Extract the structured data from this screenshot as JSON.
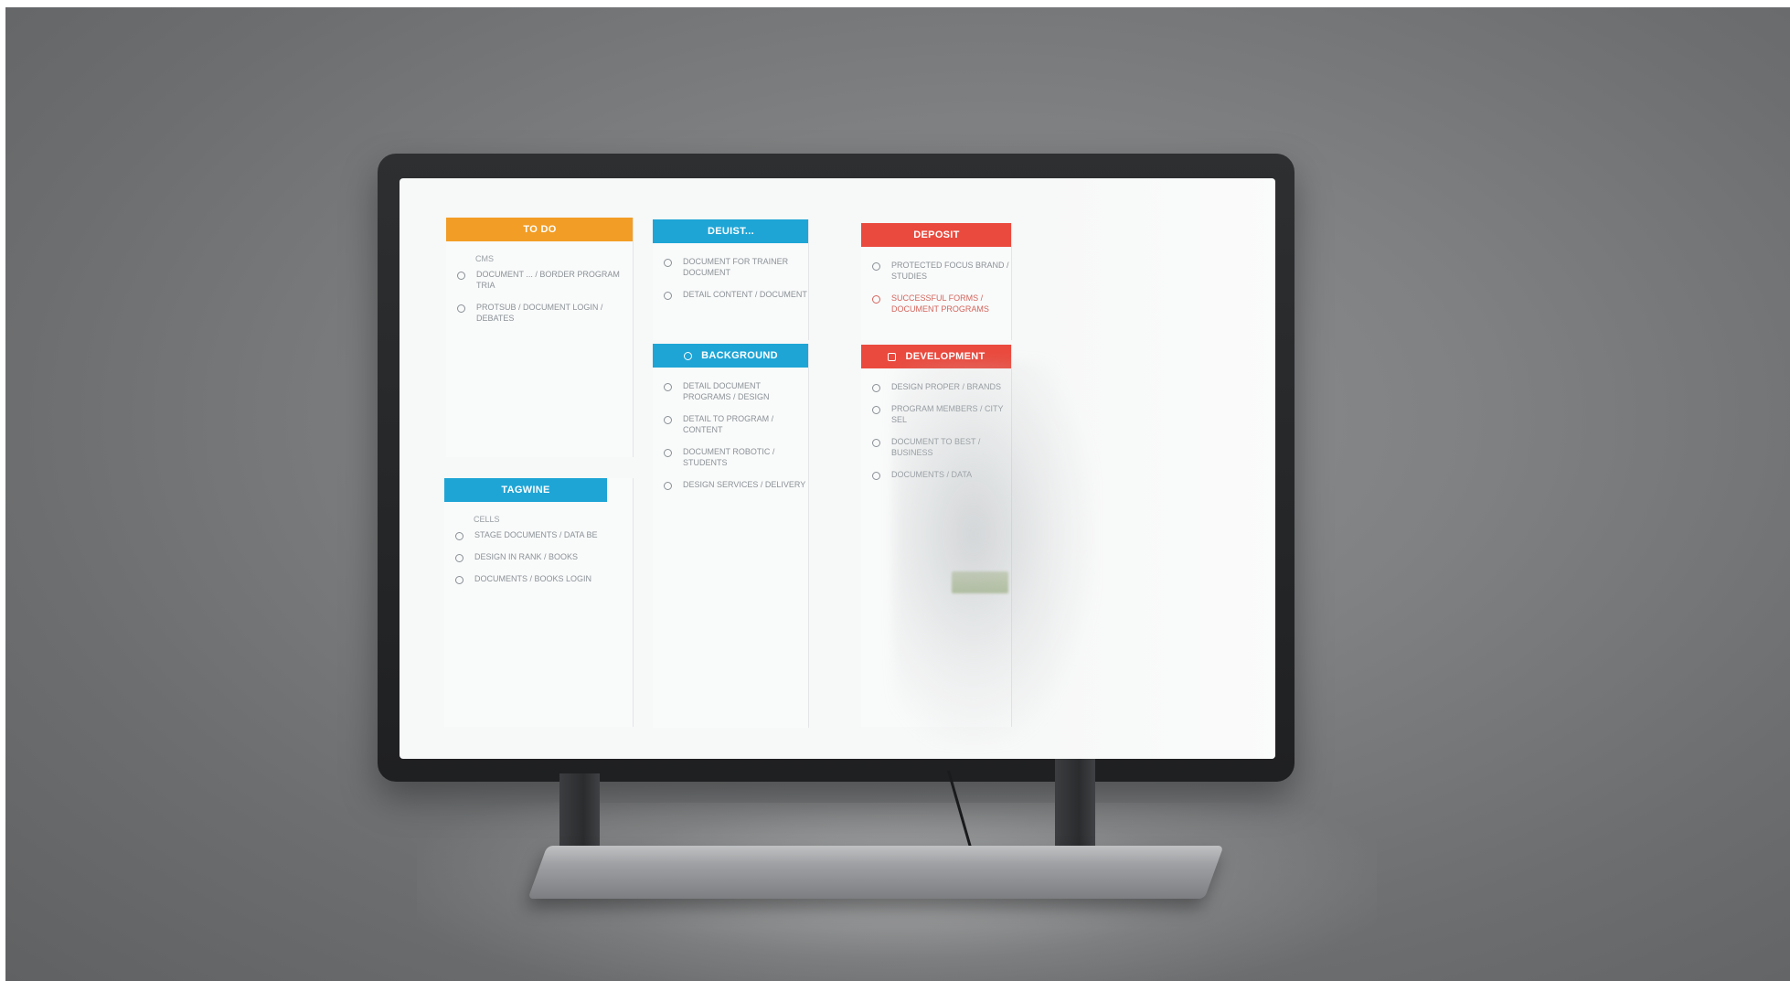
{
  "colors": {
    "orange": "#f29d25",
    "blue": "#1ea5d6",
    "red": "#ea4a3e",
    "bezel": "#232527",
    "backdrop": "#7d7f81"
  },
  "panels": [
    {
      "id": "orange-top",
      "color": "orange",
      "header": "TO DO",
      "sub": "CMS",
      "items": [
        {
          "text": "DOCUMENT ... / BORDER PROGRAM TRIA",
          "tone": "normal"
        },
        {
          "text": "PROTSUB / DOCUMENT LOGIN / DEBATES",
          "tone": "normal"
        }
      ]
    },
    {
      "id": "blue-top",
      "color": "blue",
      "header": "DEUIST...",
      "sub": "",
      "items": [
        {
          "text": "DOCUMENT FOR TRAINER DOCUMENT",
          "tone": "normal"
        },
        {
          "text": "DETAIL CONTENT / DOCUMENT",
          "tone": "normal"
        }
      ]
    },
    {
      "id": "red-top",
      "color": "red",
      "header": "DEPOSIT",
      "sub": "",
      "items": [
        {
          "text": "PROTECTED FOCUS BRAND / STUDIES",
          "tone": "normal"
        },
        {
          "text": "SUCCESSFUL FORMS / DOCUMENT PROGRAMS",
          "tone": "red"
        }
      ]
    },
    {
      "id": "blue-mid",
      "color": "blue",
      "header": "BACKGROUND",
      "sub": "",
      "items": [
        {
          "text": "DETAIL DOCUMENT PROGRAMS / DESIGN",
          "tone": "normal"
        },
        {
          "text": "DETAIL TO PROGRAM / CONTENT",
          "tone": "normal"
        },
        {
          "text": "DOCUMENT ROBOTIC / STUDENTS",
          "tone": "normal"
        },
        {
          "text": "DESIGN SERVICES / DELIVERY",
          "tone": "normal"
        }
      ]
    },
    {
      "id": "red-mid",
      "color": "red",
      "header": "DEVELOPMENT",
      "sub": "",
      "items": [
        {
          "text": "DESIGN PROPER / BRANDS",
          "tone": "normal"
        },
        {
          "text": "PROGRAM MEMBERS / CITY SEL",
          "tone": "normal"
        },
        {
          "text": "DOCUMENT TO BEST / BUSINESS",
          "tone": "normal"
        },
        {
          "text": "DOCUMENTS / DATA",
          "tone": "normal"
        }
      ]
    },
    {
      "id": "blue-bottom",
      "color": "blue",
      "header": "TAGWINE",
      "sub": "CELLS",
      "items": [
        {
          "text": "STAGE DOCUMENTS / DATA BE",
          "tone": "normal"
        },
        {
          "text": "DESIGN IN RANK / BOOKS",
          "tone": "normal"
        },
        {
          "text": "DOCUMENTS / BOOKS LOGIN",
          "tone": "normal"
        }
      ]
    }
  ]
}
